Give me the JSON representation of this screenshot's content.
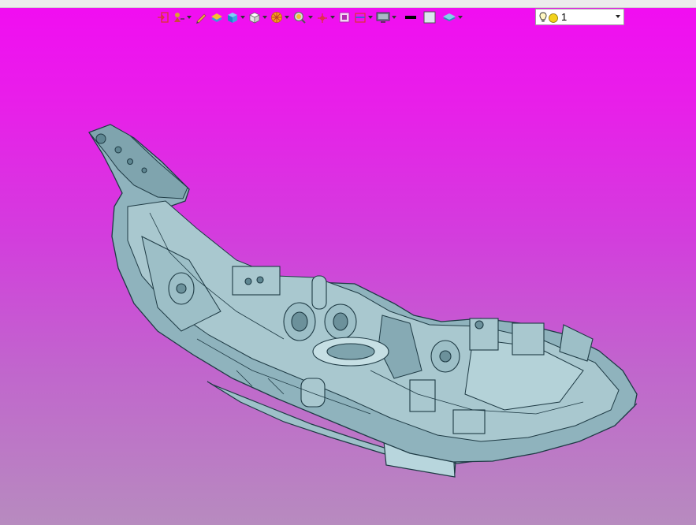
{
  "toolbar": {
    "items": [
      {
        "icon": "exit-view-icon"
      },
      {
        "icon": "pan-tool-icon",
        "dropdown": true
      },
      {
        "icon": "sketch-pencil-icon"
      },
      {
        "icon": "layer-stack-icon"
      },
      {
        "icon": "solid-box-icon",
        "dropdown": true
      },
      {
        "icon": "view-cube-icon",
        "dropdown": true
      },
      {
        "icon": "render-style-icon",
        "dropdown": true
      },
      {
        "icon": "zoom-fit-icon",
        "dropdown": true
      },
      {
        "icon": "origin-axis-icon",
        "dropdown": true
      },
      {
        "icon": "zoom-window-icon"
      },
      {
        "icon": "section-plane-icon",
        "dropdown": true
      },
      {
        "icon": "display-monitor-icon",
        "dropdown": true
      },
      {
        "icon": "line-color-swatch-icon"
      },
      {
        "icon": "fill-color-swatch-icon"
      },
      {
        "icon": "layers-toggle-icon",
        "dropdown": true
      }
    ],
    "lights": {
      "icon": "lightbulb-icon",
      "value": "1"
    }
  },
  "colors": {
    "background_top": "#f20cf2",
    "background_bottom": "#b78bbf",
    "model_fill": "#8fb3bd",
    "model_edge": "#1e3a44"
  }
}
